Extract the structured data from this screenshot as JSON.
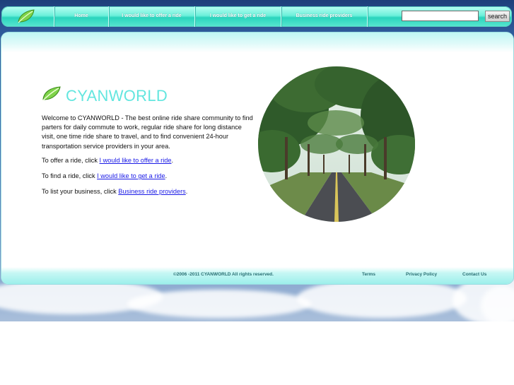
{
  "nav": {
    "items": [
      {
        "label": "Home"
      },
      {
        "label": "I would like to offer a ride"
      },
      {
        "label": "I would like to get a ride"
      },
      {
        "label": "Business ride providers"
      }
    ],
    "search_value": "",
    "search_button": "search"
  },
  "main": {
    "brand": "CYANWORLD",
    "intro": "Welcome to CYANWORLD - The best online ride share community to find parters for daily commute to work, regular ride share for long distance visit, one time ride share to travel, and to find convenient 24-hour transportation service providers in your area.",
    "offer_prefix": "To offer a ride, click ",
    "offer_link": "I would like to offer a ride",
    "find_prefix": "To find a ride, click ",
    "find_link": "I would like to get a ride",
    "list_prefix": "To list your business, click ",
    "list_link": "Business ride providers",
    "period": "."
  },
  "footer": {
    "copyright": "©2006 -2011  CYANWORLD All rights reserved.",
    "links": [
      {
        "label": "Terms"
      },
      {
        "label": "Privacy Policy"
      },
      {
        "label": "Contact Us"
      }
    ]
  },
  "colors": {
    "accent": "#63e6df",
    "nav_gradient_top": "#b9fff2",
    "nav_gradient_mid": "#2ad4bd",
    "link": "#1a1ae6"
  },
  "icons": [
    "leaf-icon",
    "leaf-logo-icon"
  ]
}
